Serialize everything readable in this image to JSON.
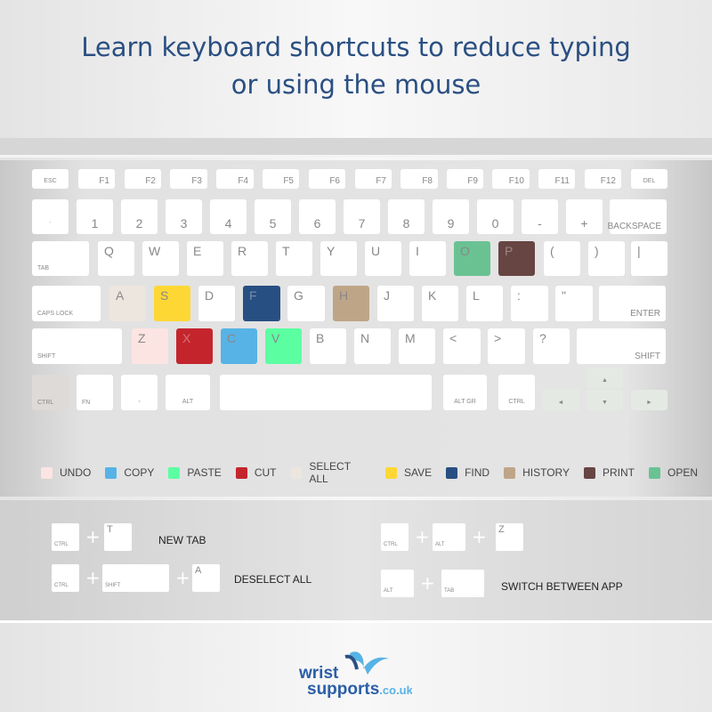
{
  "title": [
    "Learn keyboard shortcuts to reduce typing",
    "or using the mouse"
  ],
  "keyboard": {
    "rows": [
      [
        "ESC",
        "F1",
        "F2",
        "F3",
        "F4",
        "F5",
        "F6",
        "F7",
        "F8",
        "F9",
        "F10",
        "F11",
        "F12",
        "DEL"
      ],
      [
        "`",
        "1",
        "2",
        "3",
        "4",
        "5",
        "6",
        "7",
        "8",
        "9",
        "0",
        "-",
        "+",
        "BACKSPACE"
      ],
      [
        "TAB",
        "Q",
        "W",
        "E",
        "R",
        "T",
        "Y",
        "U",
        "I",
        "O",
        "P",
        "(",
        ")",
        "|"
      ],
      [
        "CAPS LOCK",
        "A",
        "S",
        "D",
        "F",
        "G",
        "H",
        "J",
        "K",
        "L",
        ":",
        "\"",
        "ENTER"
      ],
      [
        "SHIFT",
        "Z",
        "X",
        "C",
        "V",
        "B",
        "N",
        "M",
        "<",
        ">",
        "?",
        "SHIFT"
      ],
      [
        "CTRL",
        "FN",
        "◦",
        "ALT",
        "",
        "ALT GR",
        "CTRL",
        "◄",
        "▲",
        "▼",
        "►"
      ]
    ],
    "key_colors": {
      "A": "#ede6df",
      "S": "#fdd835",
      "F": "#284f82",
      "H": "#bfa588",
      "O": "#6ac293",
      "P": "#674542",
      "Z": "#fce4e2",
      "X": "#c4252d",
      "C": "#57b3e5",
      "V": "#5bffa2",
      "CTRL-left": "#dedad8",
      "arrows": "#e4e9e4"
    }
  },
  "legend": [
    {
      "label": "UNDO",
      "color": "#fce4e2"
    },
    {
      "label": "COPY",
      "color": "#57b3e5"
    },
    {
      "label": "PASTE",
      "color": "#5bffa2"
    },
    {
      "label": "CUT",
      "color": "#c4252d"
    },
    {
      "label": "SELECT ALL",
      "color": "#ede6df"
    },
    {
      "label": "SAVE",
      "color": "#fdd835"
    },
    {
      "label": "FIND",
      "color": "#284f82"
    },
    {
      "label": "HISTORY",
      "color": "#bfa588"
    },
    {
      "label": "PRINT",
      "color": "#674542"
    },
    {
      "label": "OPEN",
      "color": "#6ac293"
    }
  ],
  "shortcuts": [
    {
      "keys": [
        "CTRL",
        "T"
      ],
      "desc": "NEW TAB"
    },
    {
      "keys": [
        "CTRL",
        "SHIFT",
        "A"
      ],
      "desc": "DESELECT ALL"
    },
    {
      "keys": [
        "CTRL",
        "ALT",
        "Z"
      ],
      "desc": ""
    },
    {
      "keys": [
        "ALT",
        "TAB"
      ],
      "desc": "SWITCH BETWEEN APP"
    }
  ],
  "logo": {
    "line1": "wrist",
    "line2": "supports",
    "suffix": ".co.uk"
  }
}
